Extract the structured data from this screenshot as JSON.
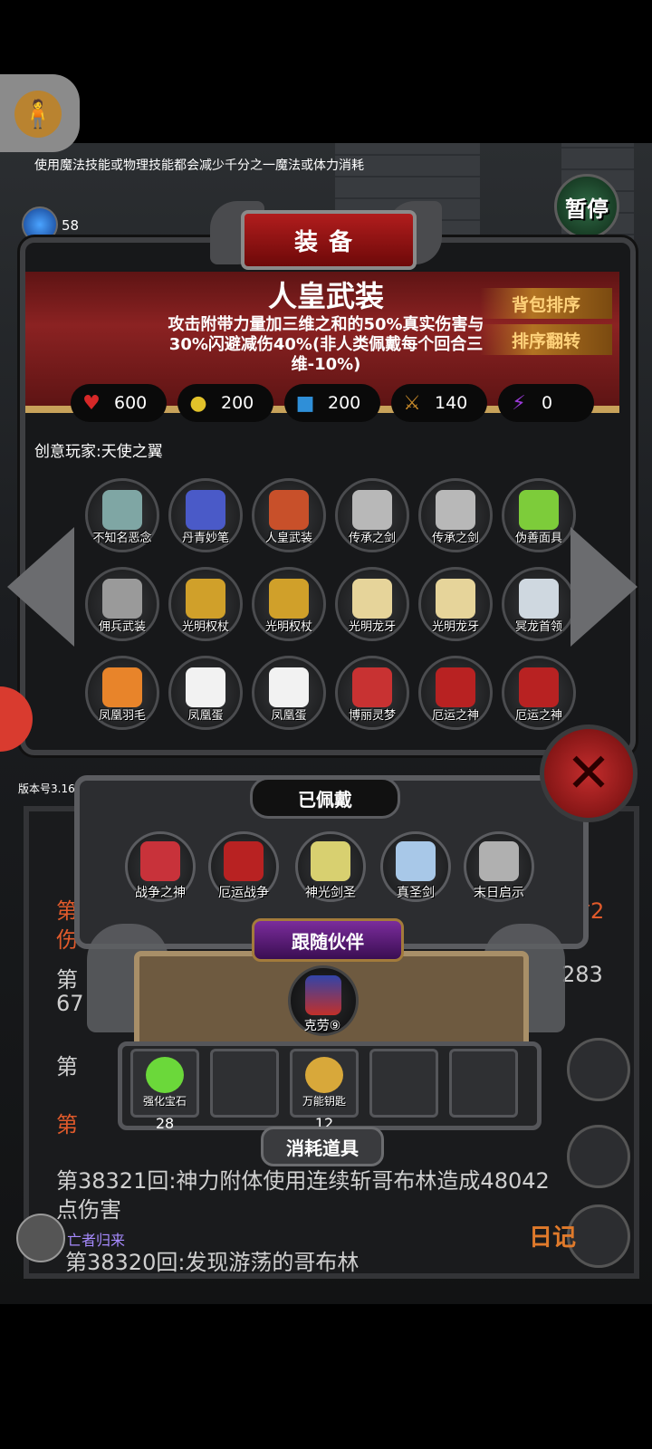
{
  "hud": {
    "tip": "使用魔法技能或物理技能都会减少千分之一魔法或体力消耗",
    "gem_count": "58",
    "pause_label": "暂停",
    "version": "版本号3.16"
  },
  "equip_panel": {
    "title": "装备",
    "item_name": "人皇武装",
    "item_desc": "攻击附带力量加三维之和的50%真实伤害与30%闪避减伤40%(非人类佩戴每个回合三维-10%)",
    "sort_btn": "背包排序",
    "flip_btn": "排序翻转",
    "stats": [
      {
        "icon": "heart-icon",
        "value": "600",
        "color": "#d62828"
      },
      {
        "icon": "strength-icon",
        "value": "200",
        "color": "#e2c22a"
      },
      {
        "icon": "agility-icon",
        "value": "200",
        "color": "#2f8fd8"
      },
      {
        "icon": "sword-icon",
        "value": "140",
        "color": "#c88a2a"
      },
      {
        "icon": "lightning-icon",
        "value": "0",
        "color": "#9a3ad8"
      }
    ],
    "creator": "创意玩家:天使之翼",
    "items": [
      {
        "label": "不知名恶念",
        "color": "#7fa6a4"
      },
      {
        "label": "丹青妙笔",
        "color": "#4a5ac8"
      },
      {
        "label": "人皇武装",
        "color": "#c8502a"
      },
      {
        "label": "传承之剑",
        "color": "#b8b8b8"
      },
      {
        "label": "传承之剑",
        "color": "#b8b8b8"
      },
      {
        "label": "伪善面具",
        "color": "#7dcc3a"
      },
      {
        "label": "佣兵武装",
        "color": "#9a9a9a"
      },
      {
        "label": "光明权杖",
        "color": "#d0a02a"
      },
      {
        "label": "光明权杖",
        "color": "#d0a02a"
      },
      {
        "label": "光明龙牙",
        "color": "#e6d49a"
      },
      {
        "label": "光明龙牙",
        "color": "#e6d49a"
      },
      {
        "label": "冥龙首领",
        "color": "#cfd8e0"
      },
      {
        "label": "凤凰羽毛",
        "color": "#e8842a"
      },
      {
        "label": "凤凰蛋",
        "color": "#f2f2f2"
      },
      {
        "label": "凤凰蛋",
        "color": "#f2f2f2"
      },
      {
        "label": "博丽灵梦",
        "color": "#c83232"
      },
      {
        "label": "厄运之神",
        "color": "#b82222"
      },
      {
        "label": "厄运之神",
        "color": "#b82222"
      }
    ]
  },
  "log": {
    "line1_left": "第",
    "line1_right": "材2",
    "line2_left": "伤",
    "line3_left": "第",
    "line3_right": "283",
    "line4_left": "67",
    "line5_left": "第",
    "line6_left": "第",
    "line7": "第38321回:神力附体使用连续斩哥布林造成48042",
    "line8": "点伤害",
    "line9": "第38320回:发现游荡的哥布林",
    "diary": "日记",
    "player_name": "亡者归来"
  },
  "equipped": {
    "title": "已佩戴",
    "items": [
      {
        "label": "战争之神",
        "color": "#c8323a"
      },
      {
        "label": "厄运战争",
        "color": "#b82222"
      },
      {
        "label": "神光剑圣",
        "color": "#d8d070"
      },
      {
        "label": "真圣剑",
        "color": "#a8c8e8"
      },
      {
        "label": "末日启示",
        "color": "#b0b0b0"
      }
    ],
    "companion_title": "跟随伙伴",
    "companion_name": "克劳⑨",
    "consumables_title": "消耗道具",
    "consumables": [
      {
        "label": "强化宝石",
        "count": "28",
        "color": "#6bd83a"
      },
      {
        "label": "",
        "count": "",
        "color": ""
      },
      {
        "label": "万能钥匙",
        "count": "12",
        "color": "#d8a83a"
      },
      {
        "label": "",
        "count": "",
        "color": ""
      },
      {
        "label": "",
        "count": "",
        "color": ""
      }
    ]
  }
}
